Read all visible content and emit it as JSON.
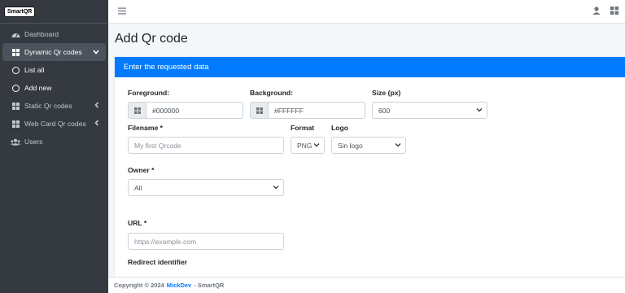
{
  "brand": {
    "logo_text": "SmartQR"
  },
  "sidebar": {
    "items": [
      {
        "label": "Dashboard",
        "icon": "dashboard-icon"
      },
      {
        "label": "Dynamic Qr codes",
        "icon": "grid-icon",
        "expanded": true
      },
      {
        "label": "List all",
        "icon": "circle-icon"
      },
      {
        "label": "Add new",
        "icon": "circle-icon"
      },
      {
        "label": "Static Qr codes",
        "icon": "grid-icon"
      },
      {
        "label": "Web Card Qr codes",
        "icon": "grid-icon"
      },
      {
        "label": "Users",
        "icon": "users-icon"
      }
    ]
  },
  "page": {
    "title": "Add Qr code"
  },
  "card": {
    "header": "Enter the requested data",
    "foreground": {
      "label": "Foreground:",
      "value": "#000000"
    },
    "background": {
      "label": "Background:",
      "value": "#FFFFFF"
    },
    "size": {
      "label": "Size (px)",
      "value": "600"
    },
    "filename": {
      "label": "Filename *",
      "placeholder": "My first Qrcode"
    },
    "format": {
      "label": "Format",
      "value": "PNG"
    },
    "logo": {
      "label": "Logo",
      "value": "Sin logo"
    },
    "owner": {
      "label": "Owner *",
      "value": "All"
    },
    "url": {
      "label": "URL *",
      "placeholder": "https://example.com"
    },
    "redirect": {
      "label": "Redirect identifier"
    }
  },
  "footer": {
    "prefix": "Copyright © 2024",
    "author": "MickDev",
    "suffix": "- SmartQR"
  },
  "colors": {
    "accent": "#007bff",
    "sidebar": "#343a40"
  }
}
